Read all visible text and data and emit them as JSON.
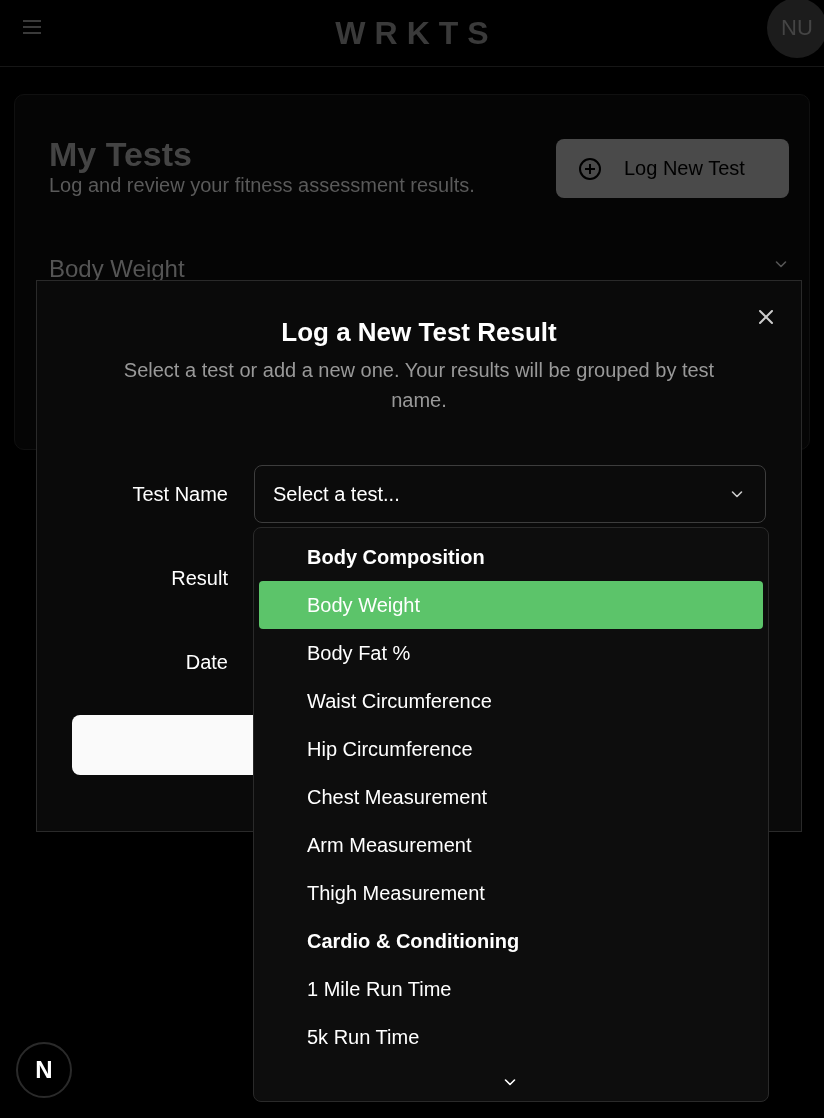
{
  "header": {
    "logo": "WRKTS",
    "avatar": "NU"
  },
  "page": {
    "title": "My Tests",
    "subtitle": "Log and review your fitness assessment results.",
    "action": "Log New Test",
    "section": "Body Weight"
  },
  "dialog": {
    "title": "Log a New Test Result",
    "description": "Select a test or add a new one. Your results will be grouped by test name.",
    "fields": [
      {
        "label": "Test Name",
        "placeholder": "Select a test...",
        "expanded": true
      },
      {
        "label": "Result"
      },
      {
        "label": "Date"
      }
    ],
    "options": [
      {
        "kind": "group",
        "label": "Body Composition"
      },
      {
        "kind": "option",
        "label": "Body Weight",
        "selected": true
      },
      {
        "kind": "option",
        "label": "Body Fat %",
        "selected": false
      },
      {
        "kind": "option",
        "label": "Waist Circumference",
        "selected": false
      },
      {
        "kind": "option",
        "label": "Hip Circumference",
        "selected": false
      },
      {
        "kind": "option",
        "label": "Chest Measurement",
        "selected": false
      },
      {
        "kind": "option",
        "label": "Arm Measurement",
        "selected": false
      },
      {
        "kind": "option",
        "label": "Thigh Measurement",
        "selected": false
      },
      {
        "kind": "group",
        "label": "Cardio & Conditioning"
      },
      {
        "kind": "option",
        "label": "1 Mile Run Time",
        "selected": false
      },
      {
        "kind": "option",
        "label": "5k Run Time",
        "selected": false
      }
    ]
  },
  "dev_badge": {
    "label": "N"
  }
}
